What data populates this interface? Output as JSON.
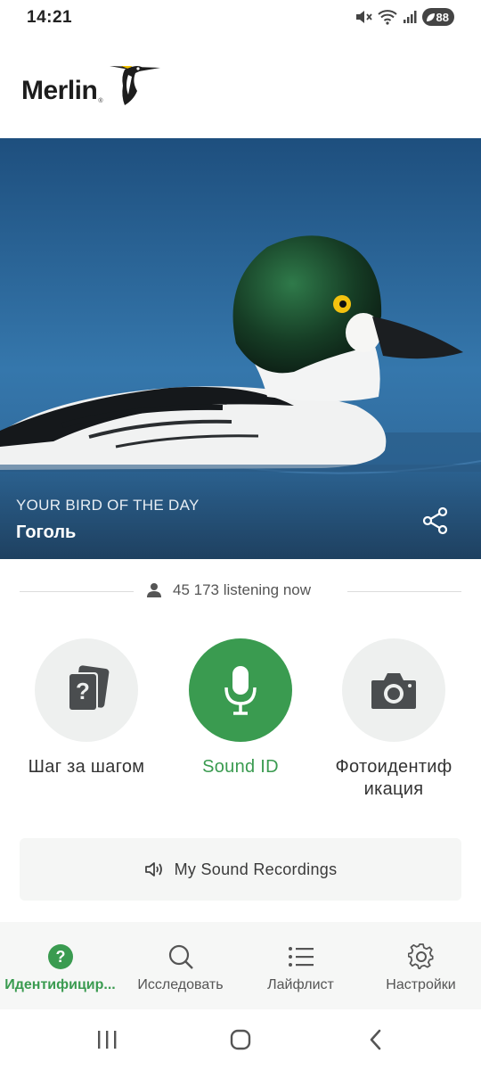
{
  "status": {
    "time": "14:21",
    "battery": "88"
  },
  "app": {
    "logo_text": "Merlin",
    "logo_reg": "®"
  },
  "hero": {
    "caption": "YOUR BIRD OF THE DAY",
    "bird_name": "Гоголь"
  },
  "listening": {
    "text": "45 173 listening now"
  },
  "actions": [
    {
      "label": "Шаг за шагом",
      "icon": "question-cards-icon"
    },
    {
      "label": "Sound ID",
      "icon": "microphone-icon"
    },
    {
      "label_line1": "Фотоидентиф",
      "label_line2": "икация",
      "icon": "camera-icon"
    }
  ],
  "recordings": {
    "label": "My Sound Recordings",
    "icon": "speaker-icon"
  },
  "nav": [
    {
      "label": "Идентифицир...",
      "icon": "question-circle-icon",
      "active": true
    },
    {
      "label": "Исследовать",
      "icon": "search-icon"
    },
    {
      "label": "Лайфлист",
      "icon": "list-icon"
    },
    {
      "label": "Настройки",
      "icon": "gear-icon"
    }
  ],
  "colors": {
    "accent": "#3a9b50",
    "water": "#2f6a9a"
  }
}
